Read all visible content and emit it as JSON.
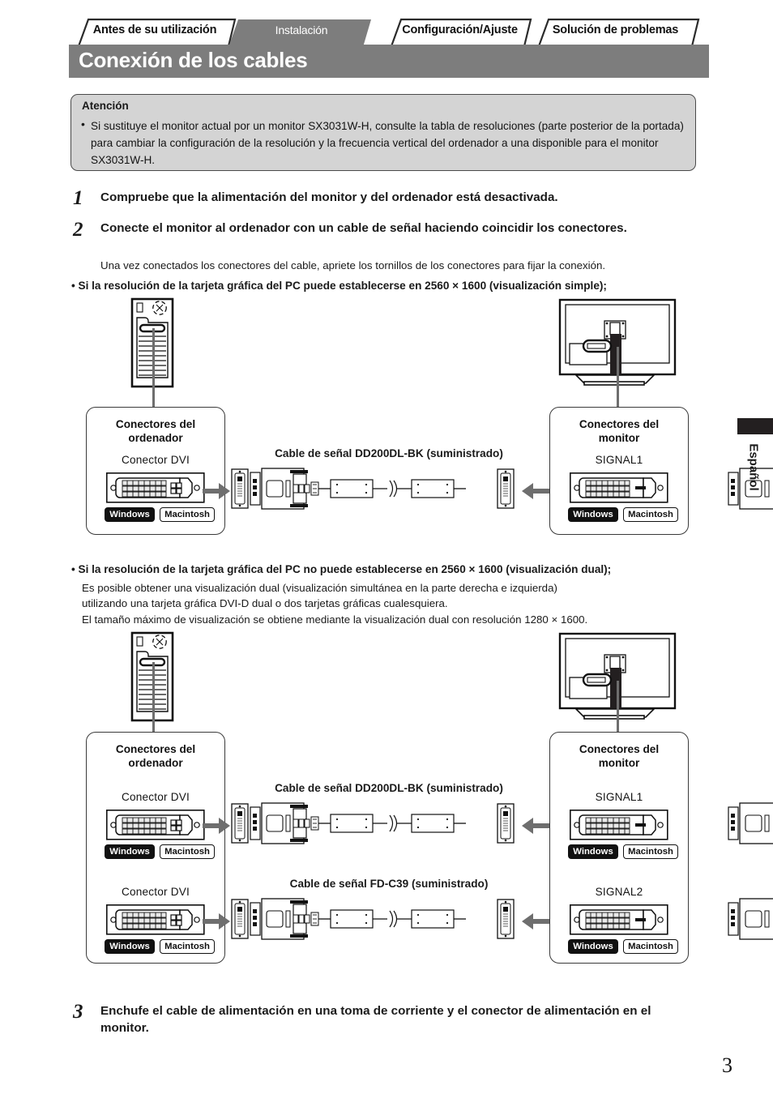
{
  "header": {
    "tabs": [
      {
        "label": "Antes de su utilización",
        "active": false
      },
      {
        "label": "Instalación",
        "active": true
      },
      {
        "label": "Configuración/Ajuste",
        "active": false
      },
      {
        "label": "Solución de problemas",
        "active": false
      }
    ],
    "title": "Conexión de los cables",
    "title_bg": "#7d7d7d",
    "active_tab_bg": "#7d7d7d"
  },
  "attention": {
    "title": "Atención",
    "bullet": "•",
    "text": "Si sustituye el monitor actual por un monitor SX3031W-H, consulte la tabla de resoluciones (parte posterior de la portada) para cambiar la configuración de la resolución y la frecuencia vertical del ordenador a una disponible para el monitor SX3031W-H."
  },
  "steps": {
    "step1": {
      "number": "1",
      "text": "Compruebe que la alimentación del monitor y del ordenador está desactivada."
    },
    "step2": {
      "number": "2",
      "text": "Conecte el monitor al ordenador con un cable de señal haciendo coincidir los conectores.",
      "sub": "Una vez conectados los conectores del cable, apriete los tornillos de los conectores para fijar la conexión."
    },
    "step3": {
      "number": "3",
      "text": "Enchufe el cable de alimentación en una toma de corriente y el conector de alimentación en el monitor."
    }
  },
  "bullets": {
    "single": "• Si la resolución de la tarjeta gráfica del PC puede establecerse en 2560 × 1600 (visualización simple);",
    "dual_head": "• Si la resolución de la tarjeta gráfica del PC no puede establecerse en 2560 × 1600 (visualización dual);",
    "dual_l1": "Es posible obtener una visualización dual (visualización simultánea en la parte derecha e izquierda)",
    "dual_l2": "utilizando una tarjeta gráfica DVI-D dual o dos tarjetas gráficas cualesquiera.",
    "dual_l3": "El tamaño máximo de visualización se obtiene mediante la visualización dual con resolución 1280 × 1600."
  },
  "diagram_single": {
    "pc_panel_title": "Conectores del\nordenador",
    "pc_panel_title_l1": "Conectores del",
    "pc_panel_title_l2": "ordenador",
    "pc_conn_label": "Conector DVI",
    "cable_label": "Cable de señal DD200DL-BK (suministrado)",
    "monitor_panel_title_l1": "Conectores del",
    "monitor_panel_title_l2": "monitor",
    "monitor_conn_label": "SIGNAL1",
    "badge_windows": "Windows",
    "badge_macintosh": "Macintosh"
  },
  "diagram_dual": {
    "pc_panel_title_l1": "Conectores del",
    "pc_panel_title_l2": "ordenador",
    "pc_conn_label_1": "Conector DVI",
    "pc_conn_label_2": "Conector DVI",
    "cable_label_1": "Cable de señal DD200DL-BK (suministrado)",
    "cable_label_2": "Cable de señal FD-C39 (suministrado)",
    "monitor_panel_title_l1": "Conectores del",
    "monitor_panel_title_l2": "monitor",
    "monitor_conn_label_1": "SIGNAL1",
    "monitor_conn_label_2": "SIGNAL2",
    "badge_windows": "Windows",
    "badge_macintosh": "Macintosh"
  },
  "side_tab": {
    "label": "Español"
  },
  "page_number": "3"
}
